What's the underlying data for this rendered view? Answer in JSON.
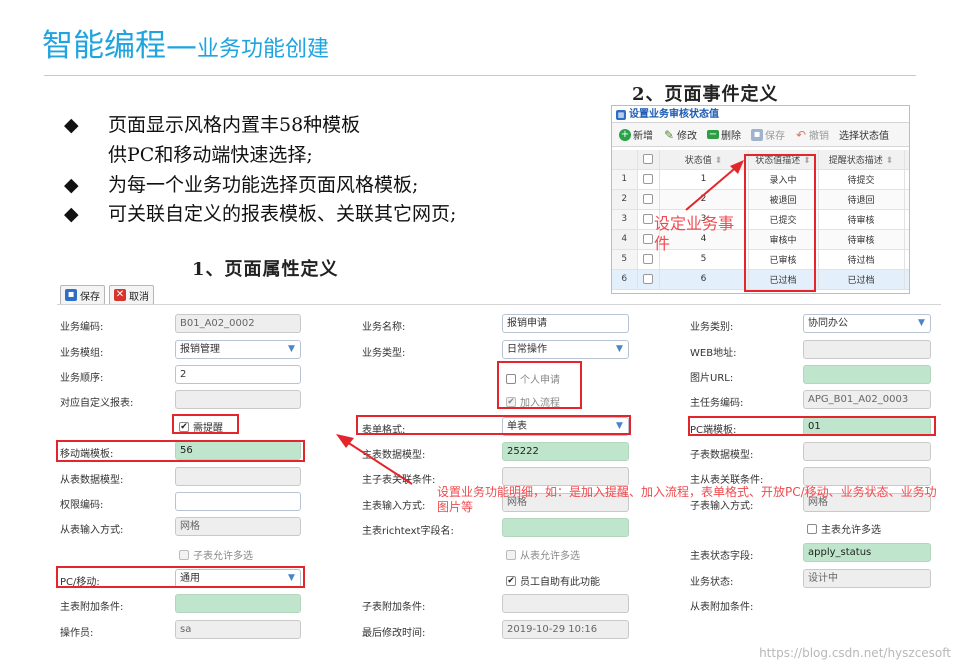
{
  "slide": {
    "title_main": "智能编程",
    "title_dash": "—",
    "title_sub": "业务功能创建",
    "bullets": [
      {
        "symbol": "◆",
        "text": "页面显示风格内置丰58种模板"
      },
      {
        "text": "供PC和移动端快速选择;"
      },
      {
        "symbol": "◆",
        "text": "为每一个业务功能选择页面风格模板;"
      },
      {
        "symbol": "◆",
        "text": "可关联自定义的报表模板、关联其它网页;"
      }
    ],
    "section_event": "2、页面事件定义",
    "section_attr": "1、页面属性定义",
    "callout_event": "设定业务事件",
    "callout_form": "设置业务功能明细，如：是加入提醒、加入流程，表单格式、开放PC/移动、业务状态、业务功图片等",
    "watermark": "https://blog.csdn.net/hyszcesoft"
  },
  "event_window": {
    "title": "设置业务审核状态值",
    "toolbar": {
      "add": "新增",
      "edit": "修改",
      "delete": "删除",
      "save": "保存",
      "cancel": "撤销",
      "select": "选择状态值"
    },
    "columns": {
      "value": "状态值",
      "desc": "状态值描述",
      "remind": "提醒状态描述"
    },
    "rows": [
      {
        "num": "1",
        "value": "1",
        "desc": "录入中",
        "remind": "待提交"
      },
      {
        "num": "2",
        "value": "2",
        "desc": "被退回",
        "remind": "待退回"
      },
      {
        "num": "3",
        "value": "3",
        "desc": "已提交",
        "remind": "待审核"
      },
      {
        "num": "4",
        "value": "4",
        "desc": "审核中",
        "remind": "待审核"
      },
      {
        "num": "5",
        "value": "5",
        "desc": "已审核",
        "remind": "待过档"
      },
      {
        "num": "6",
        "value": "6",
        "desc": "已过档",
        "remind": "已过档"
      }
    ]
  },
  "form": {
    "toolbar": {
      "save": "保存",
      "cancel": "取消"
    },
    "col1": {
      "code_label": "业务编码:",
      "code_value": "B01_A02_0002",
      "module_label": "业务模组:",
      "module_value": "报销管理",
      "order_label": "业务顺序:",
      "order_value": "2",
      "report_label": "对应自定义报表:",
      "report_value": "",
      "remind_check": "需提醒",
      "mobile_label": "移动端模板:",
      "mobile_value": "56",
      "sub_model_label": "从表数据模型:",
      "sub_model_value": "",
      "perm_label": "权限编码:",
      "perm_value": "",
      "sub_input_label": "从表输入方式:",
      "sub_input_value": "网格",
      "sub_multi_check": "子表允许多选",
      "pc_label": "PC/移动:",
      "pc_value": "通用",
      "master_cond_label": "主表附加条件:",
      "master_cond_value": "",
      "operator_label": "操作员:",
      "operator_value": "sa"
    },
    "col2": {
      "name_label": "业务名称:",
      "name_value": "报销申请",
      "type_label": "业务类型:",
      "type_value": "日常操作",
      "personal_check": "个人申请",
      "flow_check": "加入流程",
      "form_label": "表单格式:",
      "form_value": "单表",
      "master_model_label": "主表数据模型:",
      "master_model_value": "25222",
      "child_rel_label": "主子表关联条件:",
      "child_rel_value": "",
      "master_input_label": "主表输入方式:",
      "master_input_value": "网格",
      "richtext_label": "主表richtext字段名:",
      "richtext_value": "",
      "sub_multi_check": "从表允许多选",
      "staff_check": "员工自助有此功能",
      "child_cond_label": "子表附加条件:",
      "child_cond_value": "",
      "modified_label": "最后修改时间:",
      "modified_value": "2019-10-29 10:16"
    },
    "col3": {
      "category_label": "业务类别:",
      "category_value": "协同办公",
      "web_label": "WEB地址:",
      "web_value": "",
      "image_label": "图片URL:",
      "image_value": "",
      "parent_label": "主任务编码:",
      "parent_value": "APG_B01_A02_0003",
      "pcmodel_label": "PC端模板:",
      "pcmodel_value": "01",
      "sub_model_label": "子表数据模型:",
      "sub_model_value": "",
      "master_sub_rel_label": "主从表关联条件:",
      "master_sub_rel_value": "",
      "child_input_label": "子表输入方式:",
      "child_input_value": "网格",
      "master_multi_check": "主表允许多选",
      "status_field_label": "主表状态字段:",
      "status_field_value": "apply_status",
      "state_label": "业务状态:",
      "state_value": "设计中",
      "sub_cond_label": "从表附加条件:"
    }
  }
}
